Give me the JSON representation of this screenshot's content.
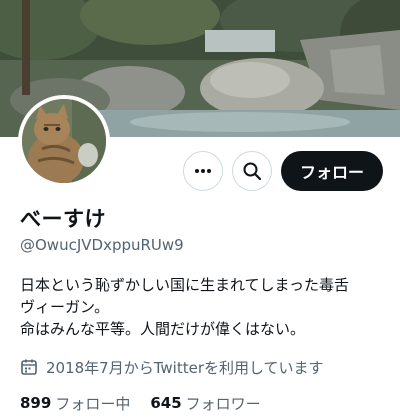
{
  "profile": {
    "display_name": "べーすけ",
    "handle": "@OwucJVDxppuRUw9",
    "bio_lines": [
      "日本という恥ずかしい国に生まれてしまった毒舌",
      "ヴィーガン。",
      "命はみんな平等。人間だけが偉くはない。"
    ],
    "joined": "2018年7月からTwitterを利用しています",
    "following_count": "899",
    "following_label": "フォロー中",
    "followers_count": "645",
    "followers_label": "フォロワー"
  },
  "actions": {
    "follow_label": "フォロー",
    "more_icon": "more-dots-icon",
    "search_icon": "search-icon"
  },
  "colors": {
    "text_primary": "#0f1419",
    "text_secondary": "#536471",
    "follow_bg": "#0f1419",
    "border": "#cfd9de"
  }
}
